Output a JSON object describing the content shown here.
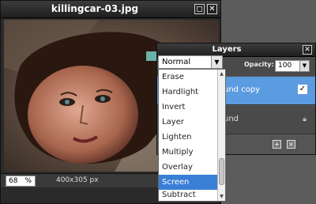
{
  "image_window": {
    "title": "killingcar-03.jpg",
    "zoom_value": "68",
    "zoom_unit": "%",
    "image_size": "400x305 px",
    "maximize_icon": "maximize-icon",
    "close_icon": "close-icon"
  },
  "layers_panel": {
    "title": "Layers",
    "opacity_label": "Opacity:",
    "opacity_value": "100",
    "close_icon": "close-icon",
    "layers": [
      {
        "name": "und copy",
        "selected": true,
        "visible": true
      },
      {
        "name": "und",
        "selected": false,
        "locked": true
      }
    ],
    "footer_icons": [
      "new-layer-icon",
      "trash-icon"
    ]
  },
  "blend_mode": {
    "selected": "Normal",
    "options": [
      "Erase",
      "Hardlight",
      "Invert",
      "Layer",
      "Lighten",
      "Multiply",
      "Overlay",
      "Screen",
      "Subtract"
    ],
    "highlighted": "Screen"
  },
  "colors": {
    "accent": "#5b9be0",
    "highlight": "#3a7fd6",
    "window_bg": "#2a2a2a",
    "desktop_bg": "#5c5c5c"
  }
}
